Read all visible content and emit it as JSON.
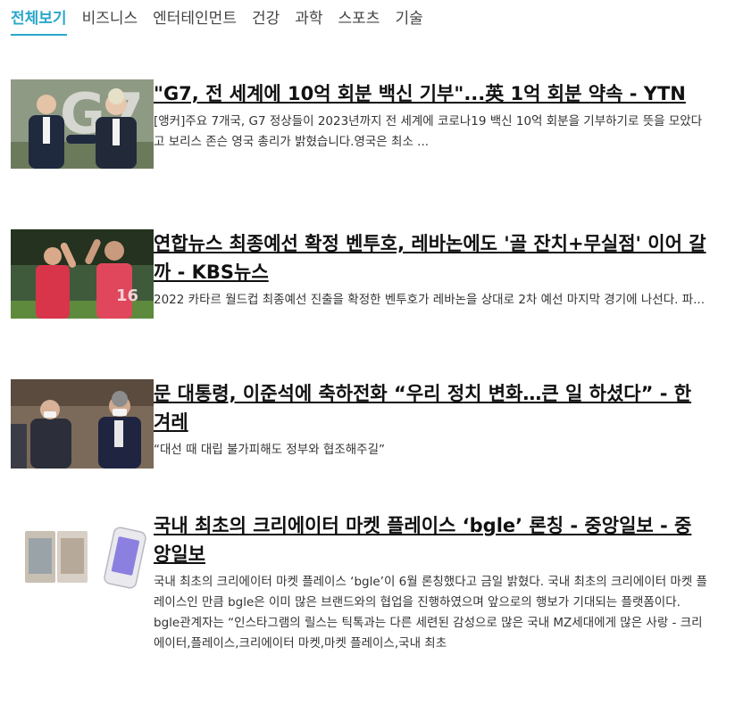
{
  "tabs": [
    {
      "label": "전체보기",
      "active": true
    },
    {
      "label": "비즈니스",
      "active": false
    },
    {
      "label": "엔터테인먼트",
      "active": false
    },
    {
      "label": "건강",
      "active": false
    },
    {
      "label": "과학",
      "active": false
    },
    {
      "label": "스포츠",
      "active": false
    },
    {
      "label": "기술",
      "active": false
    }
  ],
  "colors": {
    "accent": "#2aa7c9",
    "title": "#111111",
    "body": "#333333"
  },
  "articles": [
    {
      "title": "\"G7, 전 세계에 10억 회분 백신 기부\"...英 1억 회분 약속 - YTN",
      "description": "[앵커]주요 7개국, G7 정상들이 2023년까지 전 세계에 코로나19 백신 10억 회분을 기부하기로 뜻을 모았다고 보리스 존슨 영국 총리가 밝혔습니다.영국은 최소 ...",
      "thumbnail": "g7-leaders-photo"
    },
    {
      "title": "연합뉴스 최종예선 확정 벤투호, 레바논에도 '골 잔치+무실점' 이어 갈까 - KBS뉴스",
      "description": "2022 카타르 월드컵 최종예선 진출을 확정한 벤투호가 레바논을 상대로 2차 예선 마지막 경기에 나선다. 파...",
      "thumbnail": "soccer-players-photo"
    },
    {
      "title": "문 대통령, 이준석에 축하전화 “우리 정치 변화…큰 일 하셨다” - 한겨레",
      "description": "“대선 때 대립 불가피해도 정부와 협조해주길”",
      "thumbnail": "president-photo"
    },
    {
      "title": "국내 최초의 크리에이터 마켓 플레이스 ‘bgle’ 론칭 - 중앙일보 - 중앙일보",
      "description": "국내 최초의 크리에이터 마켓 플레이스 ‘bgle’이 6월 론칭했다고 금일 밝혔다. 국내 최초의 크리에이터 마켓 플레이스인 만큼 bgle은 이미 많은 브랜드와의 협업을 진행하였으며 앞으로의 행보가 기대되는 플랫폼이다. bgle관계자는 “인스타그램의 릴스는 틱톡과는 다른 세련된 감성으로 많은 국내 MZ세대에게 많은 사랑 - 크리에이터,플레이스,크리에이터 마켓,마켓 플레이스,국내 최초",
      "thumbnail": "app-screens-photo"
    }
  ]
}
